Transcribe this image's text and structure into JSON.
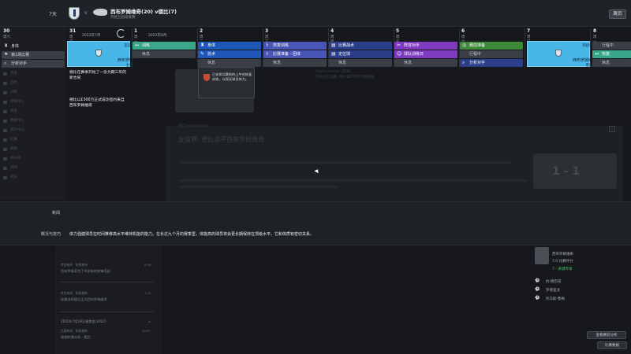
{
  "header": {
    "days": "7天",
    "vs": "v",
    "match_title": "西布罗姆维奇(20) v德比(7)",
    "match_sub": "英格兰超级联赛",
    "skip_label": "跳页"
  },
  "sidebar": {
    "week_num": "30",
    "week_day": "周六",
    "items": [
      {
        "label": "身体",
        "icon": "♜"
      },
      {
        "label": "第1场比赛",
        "icon": "⚑"
      },
      {
        "label": "分析对手",
        "icon": "⌕"
      }
    ],
    "dim_items": [
      "阵容",
      "战术",
      "训练",
      "球探中心",
      "转会",
      "数据中心",
      "医疗中心",
      "比赛",
      "联赛",
      "俱乐部",
      "财政",
      "职员"
    ]
  },
  "calendar": {
    "month_label_1": "2022年7月",
    "month_label_2": "2022年8月",
    "days": [
      {
        "num": "31",
        "wk": "周日"
      },
      {
        "num": "1",
        "wk": "周一"
      },
      {
        "num": "2",
        "wk": "周二"
      },
      {
        "num": "3",
        "wk": "周三"
      },
      {
        "num": "4",
        "wk": "周四"
      },
      {
        "num": "5",
        "wk": "周五"
      },
      {
        "num": "6",
        "wk": "周六"
      },
      {
        "num": "7",
        "wk": "周日"
      },
      {
        "num": "8",
        "wk": "周一"
      }
    ],
    "match_card_1": {
      "top": "友谊赛",
      "name": "西布罗姆维奇",
      "bottom": "主场"
    },
    "match_card_2": {
      "top": "英超联赛",
      "name": "西布罗姆维奇 (20)",
      "bottom": "客场"
    },
    "events": {
      "d1_1": "训练",
      "d1_2": "休息",
      "d2_1": "身体",
      "d2_2": "技术",
      "d2_3": "休息",
      "d3_1": "恢复训练",
      "d3_2": "比赛准备 - 团体",
      "d3_3": "休息",
      "d4_1": "比赛战术",
      "d4_2": "定位球",
      "d4_3": "休息",
      "d5_1": "阵容对手",
      "d5_2": "球队训练日",
      "d5_3": "休息",
      "d6_1": "赛前准备",
      "d6_2": "行程中",
      "d6_3": "分析对手",
      "d8_1": "行程中",
      "d8_2": "恢复",
      "d8_3": "休息"
    },
    "notes": [
      "德比在赛季开始了一份为期三年的新合同",
      "德比以£300万正式成功签约来自西布罗姆维奇"
    ]
  },
  "tooltip": {
    "text": "已安排比赛前的上午的恢复训练，以保证球员体力。"
  },
  "bg": {
    "headline": "友谊赛: 德比逼平西布罗姆维奇",
    "sub_line": "英格兰友谊赛: 德比逼平西布罗姆维奇",
    "source": "来自 Footie news",
    "from_label": "Footie moster (新闻)",
    "score": "1 - 1"
  },
  "infobar": {
    "k1": "新闻",
    "k2": "概况与技巧",
    "v2": "体力强健球员在时间推移高水平维持机能的能力。在长达九个月的赛季里，体能高的球员将会更长期保持在顶级水平。它和体质有密切关系。"
  },
  "news": [
    {
      "t1": "转会新闻 · 刚刚更新",
      "t2": "西布罗维奇为了寻求新的前锋而出",
      "time": "0:56"
    },
    {
      "t1": "转会新闻 · 刚刚更新",
      "t2": "轮换选择德比正式西布罗姆维奇",
      "time": "7:41"
    },
    {
      "t1": "比赛新闻 · 刚刚更新",
      "t2": "电视转播分析 - 德比",
      "time": "10:57"
    }
  ],
  "news_date": "2022年7月29日星期五(2022)",
  "player": {
    "name": "西布罗姆维奇",
    "rating": "7.0 比赛评分",
    "green": "7 - 关键传球"
  },
  "scorers": [
    {
      "icon": "⚽",
      "name": "约·德巴塔"
    },
    {
      "icon": "⚽",
      "name": "罗德里戈"
    },
    {
      "icon": "⚽",
      "name": "托马斯·鲁梅"
    }
  ],
  "buttons": {
    "more_stats": "查看赛前分析",
    "match_stats": "比赛数据"
  }
}
